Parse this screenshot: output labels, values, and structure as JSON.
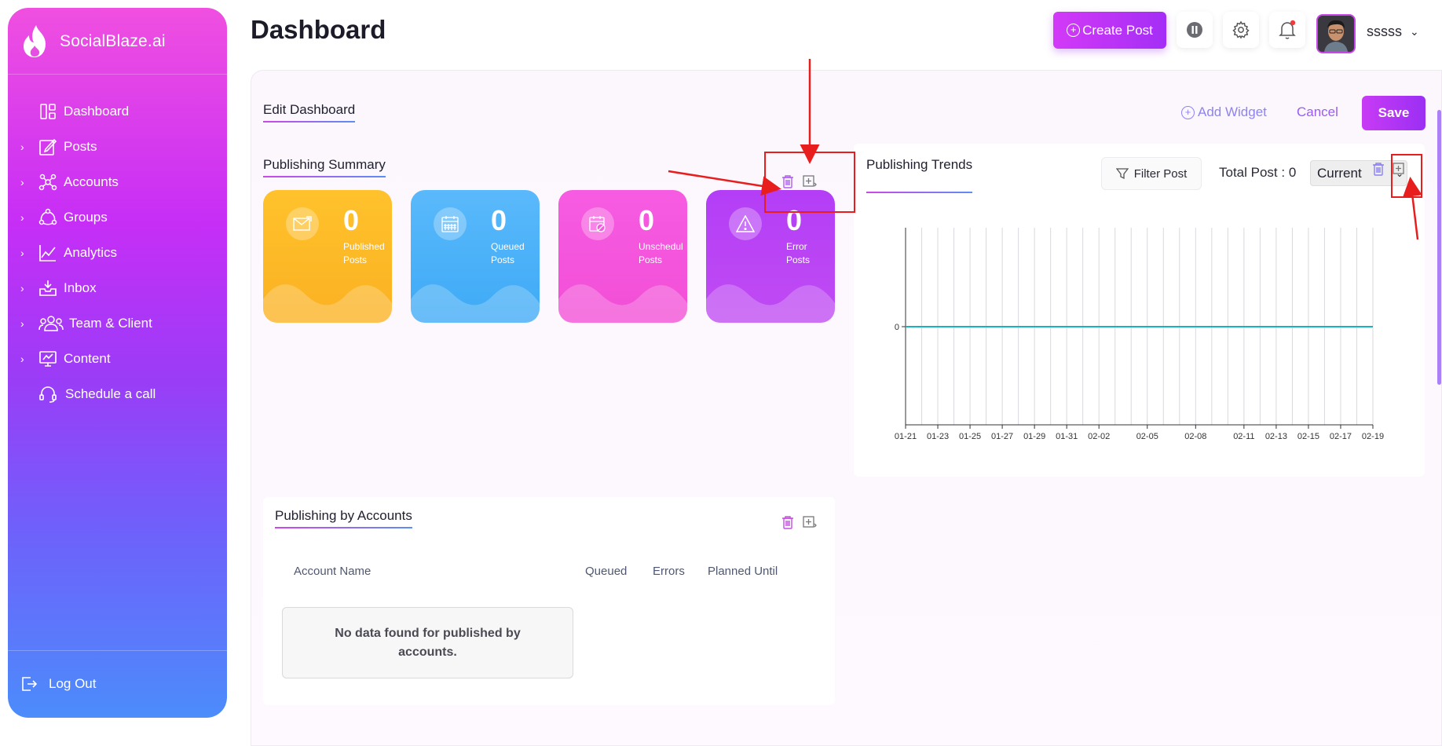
{
  "brand": {
    "name": "SocialBlaze.ai"
  },
  "sidebar": {
    "items": [
      {
        "label": "Dashboard",
        "icon": "dashboard-icon",
        "expandable": false
      },
      {
        "label": "Posts",
        "icon": "edit-icon",
        "expandable": true
      },
      {
        "label": "Accounts",
        "icon": "accounts-icon",
        "expandable": true
      },
      {
        "label": "Groups",
        "icon": "groups-icon",
        "expandable": true
      },
      {
        "label": "Analytics",
        "icon": "analytics-icon",
        "expandable": true
      },
      {
        "label": "Inbox",
        "icon": "inbox-icon",
        "expandable": true
      },
      {
        "label": "Team & Client",
        "icon": "team-icon",
        "expandable": true
      },
      {
        "label": "Content",
        "icon": "content-icon",
        "expandable": true
      },
      {
        "label": "Schedule a call",
        "icon": "headset-icon",
        "expandable": false
      }
    ],
    "logout_label": "Log Out"
  },
  "header": {
    "title": "Dashboard",
    "create_post_label": "Create Post",
    "username": "sssss"
  },
  "toolbar": {
    "edit_dashboard_label": "Edit Dashboard",
    "add_widget_label": "Add Widget",
    "cancel_label": "Cancel",
    "save_label": "Save"
  },
  "publishing_summary": {
    "title": "Publishing Summary",
    "cards": [
      {
        "value": "0",
        "label_line1": "Published",
        "label_line2": "Posts",
        "color": "#fdb825"
      },
      {
        "value": "0",
        "label_line1": "Queued",
        "label_line2": "Posts",
        "color": "#49b3f9"
      },
      {
        "value": "0",
        "label_line1": "Unschedul",
        "label_line2": "Posts",
        "color": "#f554dc"
      },
      {
        "value": "0",
        "label_line1": "Error",
        "label_line2": "Posts",
        "color": "#b443f6"
      }
    ]
  },
  "publishing_trends": {
    "title": "Publishing Trends",
    "filter_label": "Filter Post",
    "total_post_label": "Total Post : 0",
    "period_selected": "Current"
  },
  "chart_data": {
    "type": "line",
    "x": [
      "01-21",
      "01-23",
      "01-25",
      "01-27",
      "01-29",
      "01-31",
      "02-02",
      "02-05",
      "02-08",
      "02-11",
      "02-13",
      "02-15",
      "02-17",
      "02-19"
    ],
    "series": [
      {
        "values": [
          0,
          0,
          0,
          0,
          0,
          0,
          0,
          0,
          0,
          0,
          0,
          0,
          0,
          0
        ],
        "color": "#18b3c0"
      }
    ],
    "y_ticks": [
      "0"
    ],
    "grid": "vertical"
  },
  "publishing_by_accounts": {
    "title": "Publishing by Accounts",
    "columns": [
      "Account Name",
      "Queued",
      "Errors",
      "Planned Until"
    ],
    "empty_message": "No data found for published by accounts."
  }
}
